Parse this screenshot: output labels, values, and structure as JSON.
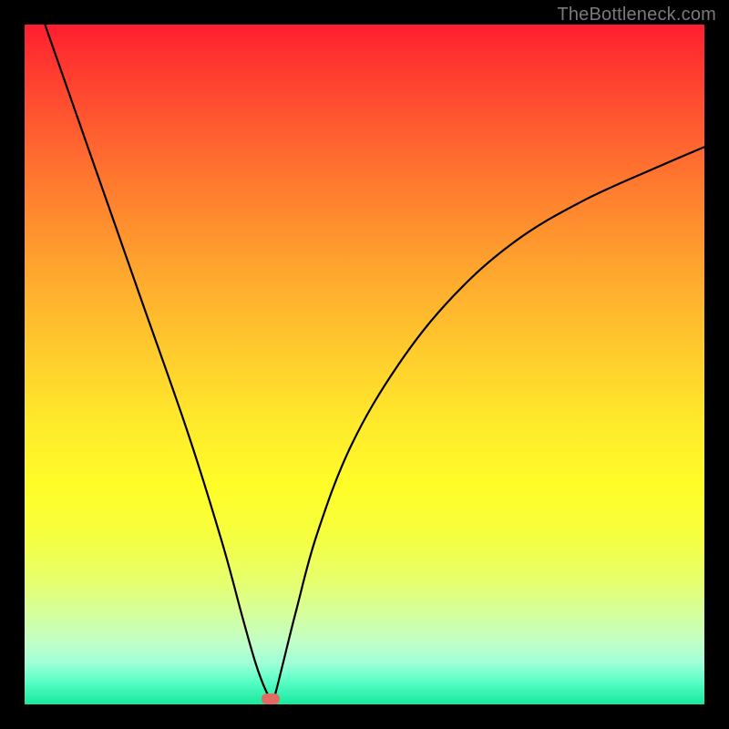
{
  "watermark": "TheBottleneck.com",
  "colors": {
    "page_bg": "#000000",
    "curve": "#000000",
    "marker": "#e26a61",
    "watermark": "#7a7a7a"
  },
  "chart_data": {
    "type": "line",
    "title": "",
    "xlabel": "",
    "ylabel": "",
    "xlim": [
      0,
      100
    ],
    "ylim": [
      0,
      100
    ],
    "grid": false,
    "legend": false,
    "series": [
      {
        "name": "bottleneck-curve",
        "x": [
          3,
          10,
          17,
          24,
          29,
          32,
          34,
          35.5,
          36.5,
          37,
          38,
          40,
          43,
          48,
          55,
          63,
          72,
          82,
          93,
          100
        ],
        "y": [
          100,
          80,
          60,
          40,
          24,
          13,
          6,
          2,
          0.5,
          2,
          6,
          14,
          25,
          38,
          50,
          60,
          68,
          74,
          79,
          82
        ]
      }
    ],
    "marker": {
      "x": 36.2,
      "y": 0.8
    }
  }
}
